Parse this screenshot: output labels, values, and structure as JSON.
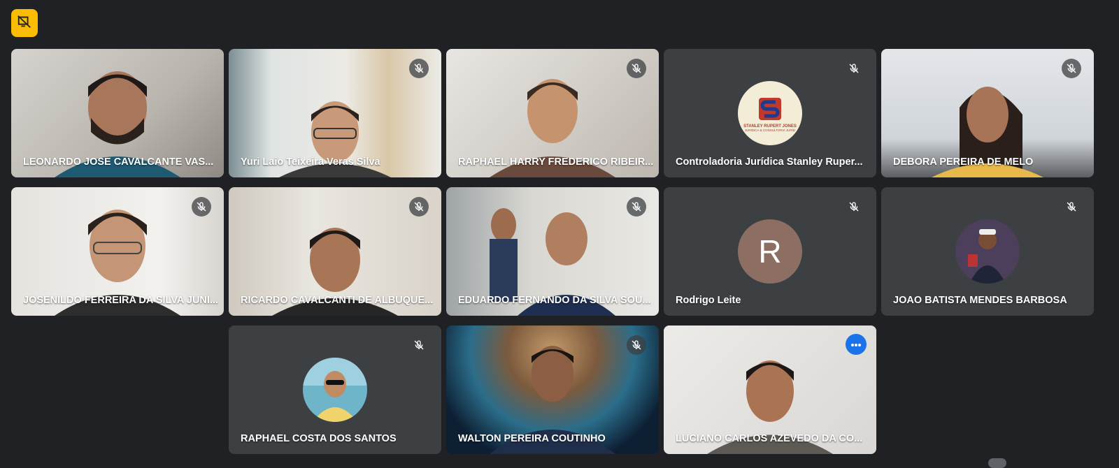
{
  "toolbar": {
    "toggle_icon": "visibility-off-icon",
    "color": "#fbbc04"
  },
  "participants": [
    {
      "name": "LEONARDO JOSE CAVALCANTE VAS...",
      "muted": false
    },
    {
      "name": "Yuri Laio Teixeira Veras Silva",
      "muted": true
    },
    {
      "name": "RAPHAEL HARRY FREDERICO RIBEIR...",
      "muted": true
    },
    {
      "name": "Controladoria Jurídica Stanley Ruper...",
      "muted": true,
      "logo_line1": "STANLEY RUPERT JONES",
      "logo_line2": "JURÍDICA & CONSULTORIA JURÍD"
    },
    {
      "name": "DEBORA PEREIRA DE MELO",
      "muted": true
    },
    {
      "name": "JOSENILDO FERREIRA DA SILVA JUNI...",
      "muted": true
    },
    {
      "name": "RICARDO CAVALCANTI DE ALBUQUE...",
      "muted": true
    },
    {
      "name": "EDUARDO FERNANDO DA SILVA SOU...",
      "muted": true
    },
    {
      "name": "Rodrigo Leite",
      "muted": true,
      "avatar_letter": "R"
    },
    {
      "name": "JOAO BATISTA MENDES BARBOSA",
      "muted": true
    },
    {
      "name": "RAPHAEL COSTA DOS SANTOS",
      "muted": true
    },
    {
      "name": "WALTON PEREIRA COUTINHO",
      "muted": true
    },
    {
      "name": "LUCIANO CARLOS AZEVEDO DA CO...",
      "muted": false,
      "active_speaker": true
    }
  ],
  "colors": {
    "background": "#202124",
    "tile": "#3c4043",
    "accent": "#1a73e8",
    "active_border": "#8ab4f8"
  }
}
